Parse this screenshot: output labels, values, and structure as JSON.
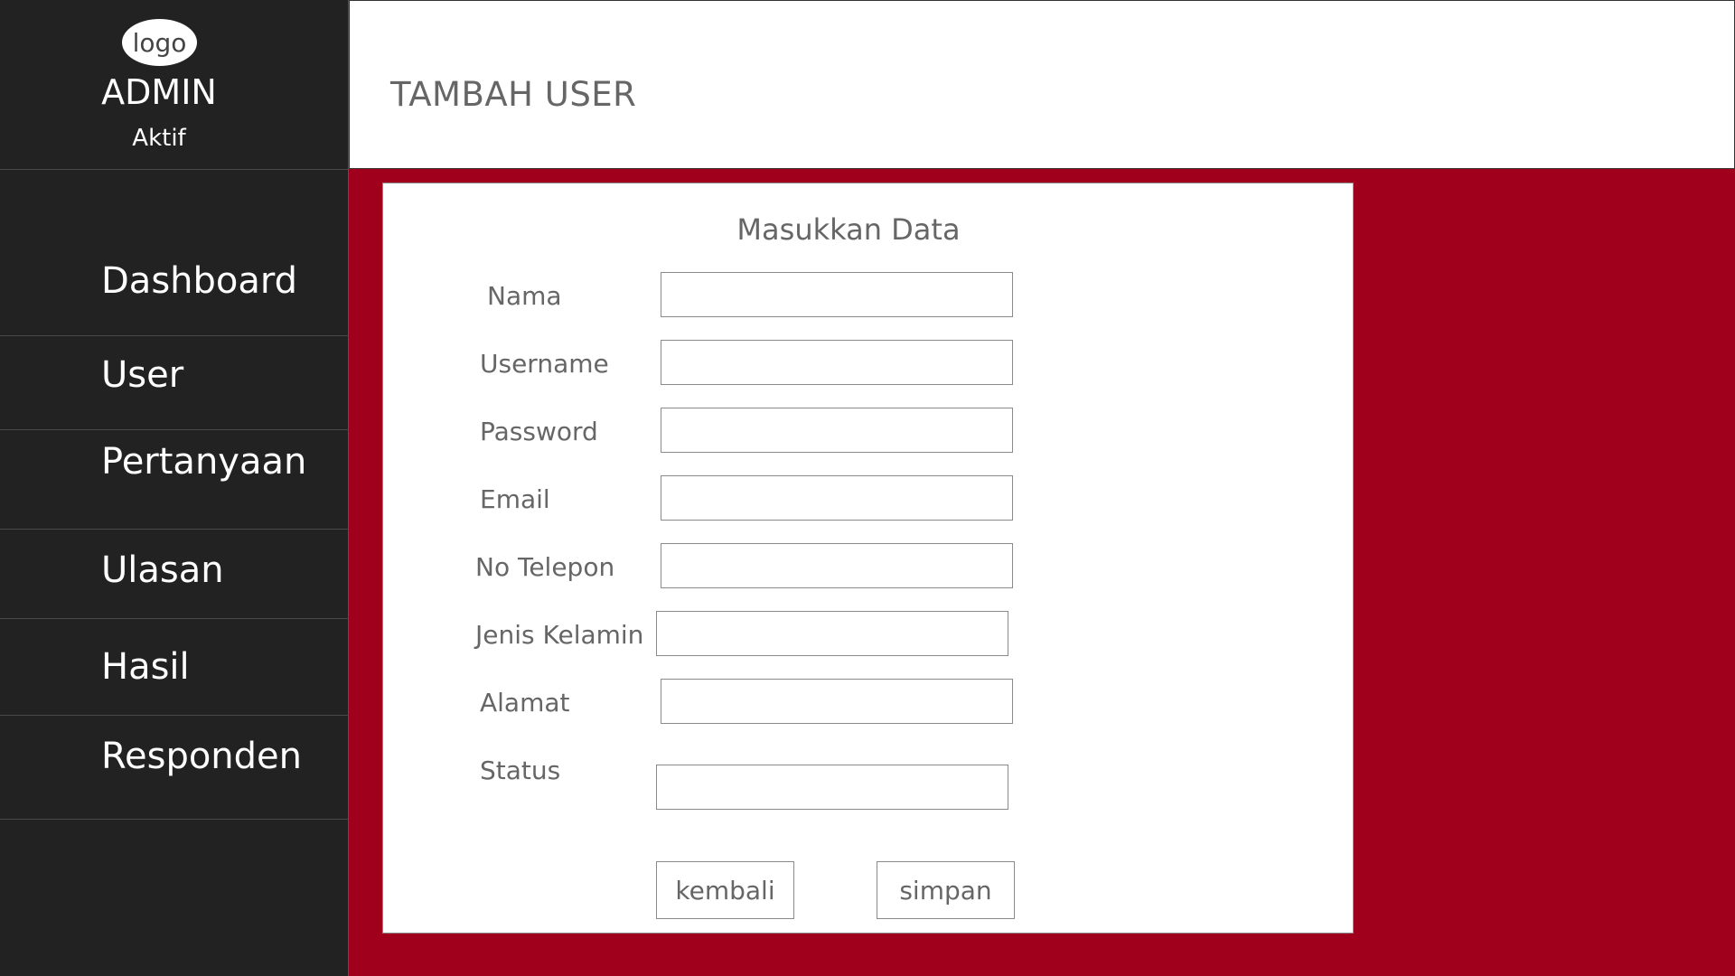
{
  "sidebar": {
    "logo_text": "logo",
    "admin_name": "ADMIN",
    "admin_status": "Aktif",
    "nav": [
      {
        "label": "Dashboard"
      },
      {
        "label": "User"
      },
      {
        "label": "Pertanyaan"
      },
      {
        "label": "Ulasan"
      },
      {
        "label": "Hasil"
      },
      {
        "label": "Responden"
      }
    ]
  },
  "header": {
    "title": "TAMBAH USER"
  },
  "form": {
    "title": "Masukkan Data",
    "fields": [
      {
        "label": "Nama",
        "value": ""
      },
      {
        "label": "Username",
        "value": ""
      },
      {
        "label": "Password",
        "value": ""
      },
      {
        "label": "Email",
        "value": ""
      },
      {
        "label": "No Telepon",
        "value": ""
      },
      {
        "label": "Jenis Kelamin",
        "value": ""
      },
      {
        "label": "Alamat",
        "value": ""
      },
      {
        "label": "Status",
        "value": ""
      }
    ],
    "back_label": "kembali",
    "save_label": "simpan"
  },
  "colors": {
    "sidebar_bg": "#222222",
    "main_bg": "#a0001c",
    "text_gray": "#666666"
  }
}
